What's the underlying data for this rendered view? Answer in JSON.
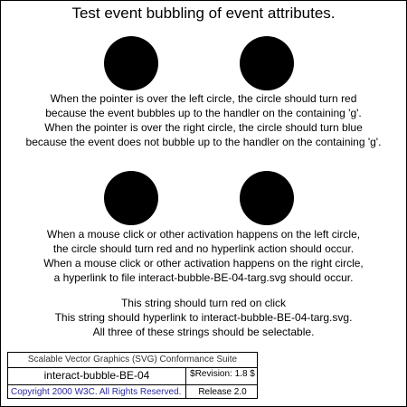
{
  "title": "Test event bubbling of event attributes.",
  "paragraph1": [
    "When the pointer is over the left circle, the circle should turn red",
    "because the event bubbles up to the handler on the containing 'g'.",
    "When the pointer is over the right circle, the circle should turn blue",
    "because the event does not bubble up to the handler on the containing 'g'."
  ],
  "paragraph2": [
    "When a mouse click or other activation happens on the left circle,",
    "the circle should turn red and no hyperlink action should occur.",
    "When a mouse click or other activation happens on the right circle,",
    "a hyperlink to file interact-bubble-BE-04-targ.svg should occur."
  ],
  "paragraph3": {
    "line1": "This string should turn red on click",
    "line2": "This string should hyperlink to interact-bubble-BE-04-targ.svg.",
    "line3": "All three of these strings should be selectable."
  },
  "legend": {
    "suite": "Scalable Vector Graphics (SVG) Conformance Suite",
    "test_name": "interact-bubble-BE-04",
    "revision": "$Revision: 1.8 $",
    "copyright": "Copyright 2000 W3C. All Rights Reserved.",
    "release": "Release 2.0"
  },
  "colors": {
    "circle": "#000000",
    "copyright_text": "#2a2aa6"
  }
}
